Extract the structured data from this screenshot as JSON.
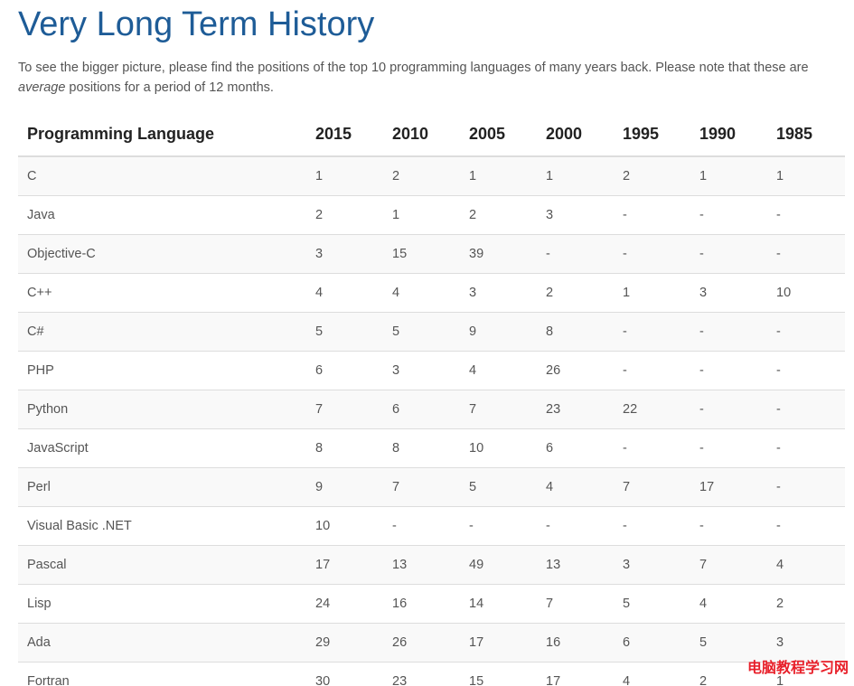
{
  "page": {
    "title": "Very Long Term History",
    "intro_part1": "To see the bigger picture, please find the positions of the top 10 programming languages of many years back. Please note that these are ",
    "intro_emphasis": "average",
    "intro_part2": " positions for a period of 12 months."
  },
  "table": {
    "headers": [
      "Programming Language",
      "2015",
      "2010",
      "2005",
      "2000",
      "1995",
      "1990",
      "1985"
    ],
    "rows": [
      [
        "C",
        "1",
        "2",
        "1",
        "1",
        "2",
        "1",
        "1"
      ],
      [
        "Java",
        "2",
        "1",
        "2",
        "3",
        "-",
        "-",
        "-"
      ],
      [
        "Objective-C",
        "3",
        "15",
        "39",
        "-",
        "-",
        "-",
        "-"
      ],
      [
        "C++",
        "4",
        "4",
        "3",
        "2",
        "1",
        "3",
        "10"
      ],
      [
        "C#",
        "5",
        "5",
        "9",
        "8",
        "-",
        "-",
        "-"
      ],
      [
        "PHP",
        "6",
        "3",
        "4",
        "26",
        "-",
        "-",
        "-"
      ],
      [
        "Python",
        "7",
        "6",
        "7",
        "23",
        "22",
        "-",
        "-"
      ],
      [
        "JavaScript",
        "8",
        "8",
        "10",
        "6",
        "-",
        "-",
        "-"
      ],
      [
        "Perl",
        "9",
        "7",
        "5",
        "4",
        "7",
        "17",
        "-"
      ],
      [
        "Visual Basic .NET",
        "10",
        "-",
        "-",
        "-",
        "-",
        "-",
        "-"
      ],
      [
        "Pascal",
        "17",
        "13",
        "49",
        "13",
        "3",
        "7",
        "4"
      ],
      [
        "Lisp",
        "24",
        "16",
        "14",
        "7",
        "5",
        "4",
        "2"
      ],
      [
        "Ada",
        "29",
        "26",
        "17",
        "16",
        "6",
        "5",
        "3"
      ],
      [
        "Fortran",
        "30",
        "23",
        "15",
        "17",
        "4",
        "2",
        "1"
      ]
    ]
  },
  "watermark": {
    "text": "电脑教程学习网",
    "color": "#e8202a"
  },
  "colors": {
    "title": "#1e5c97",
    "row_stripe": "#f9f9f9",
    "border": "#dddddd"
  }
}
